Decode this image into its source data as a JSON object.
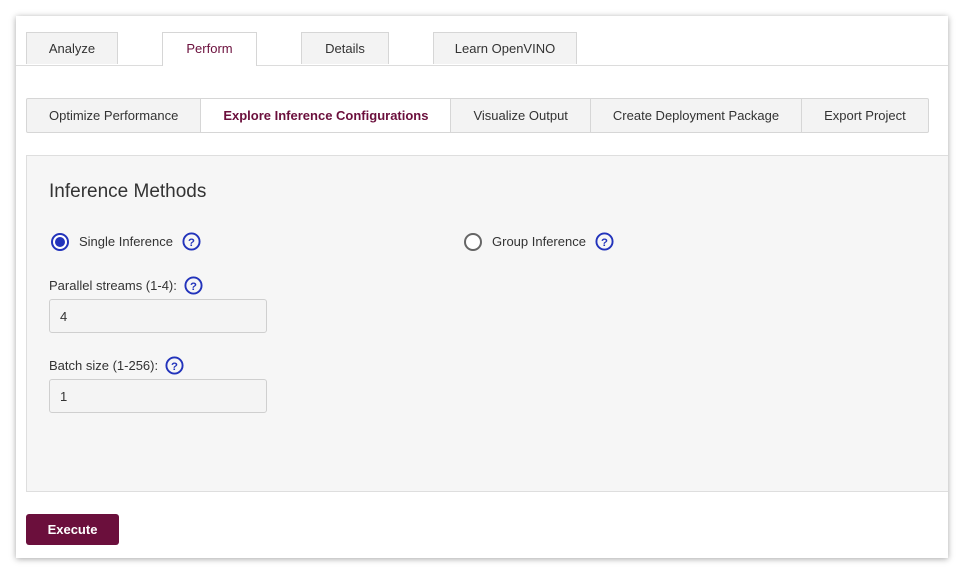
{
  "top_tabs": [
    {
      "label": "Analyze"
    },
    {
      "label": "Perform"
    },
    {
      "label": "Details"
    },
    {
      "label": "Learn OpenVINO"
    }
  ],
  "sub_tabs": [
    {
      "label": "Optimize Performance"
    },
    {
      "label": "Explore Inference Configurations"
    },
    {
      "label": "Visualize Output"
    },
    {
      "label": "Create Deployment Package"
    },
    {
      "label": "Export Project"
    }
  ],
  "inference": {
    "title": "Inference Methods",
    "single_label": "Single Inference",
    "group_label": "Group Inference",
    "selected": "single",
    "parallel_streams_label": "Parallel streams (1-4):",
    "parallel_streams_value": "4",
    "batch_size_label": "Batch size (1-256):",
    "batch_size_value": "1"
  },
  "actions": {
    "execute_label": "Execute"
  },
  "colors": {
    "accent": "#6b0f3c",
    "radio_selected": "#2233bb",
    "help_icon": "#2233bb"
  },
  "icons": {
    "help": "question-circle-icon"
  }
}
